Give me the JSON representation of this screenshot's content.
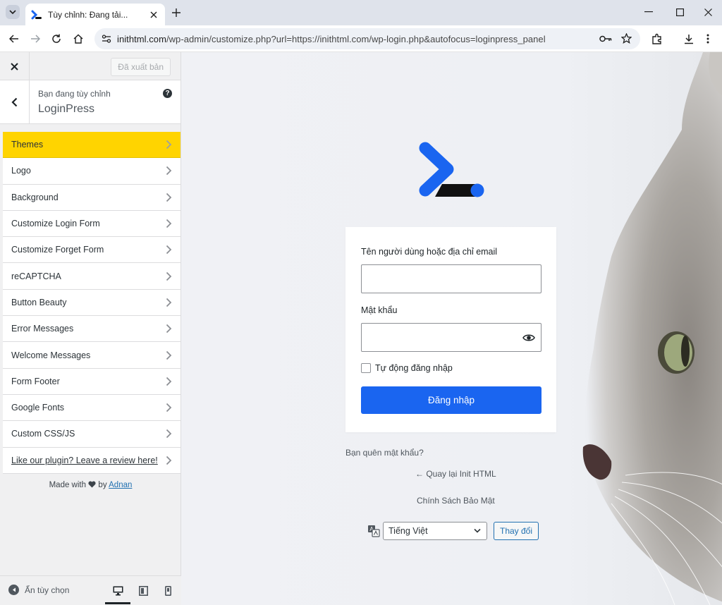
{
  "browser": {
    "tab_title": "Tùy chỉnh: Đang tải...",
    "url_host": "inithtml.com",
    "url_rest": "/wp-admin/customize.php?url=https://inithtml.com/wp-login.php&autofocus=loginpress_panel"
  },
  "sidebar": {
    "publish_label": "Đã xuất bản",
    "customizing_label": "Bạn đang tùy chỉnh",
    "panel_title": "LoginPress",
    "help": "?",
    "items": [
      {
        "label": "Themes"
      },
      {
        "label": "Logo"
      },
      {
        "label": "Background"
      },
      {
        "label": "Customize Login Form"
      },
      {
        "label": "Customize Forget Form"
      },
      {
        "label": "reCAPTCHA"
      },
      {
        "label": "Button Beauty"
      },
      {
        "label": "Error Messages"
      },
      {
        "label": "Welcome Messages"
      },
      {
        "label": "Form Footer"
      },
      {
        "label": "Google Fonts"
      },
      {
        "label": "Custom CSS/JS"
      },
      {
        "label": "Like our plugin? Leave a review here!"
      }
    ],
    "credit_prefix": "Made with",
    "credit_by": "by",
    "credit_author": "Adnan",
    "hide_controls": "Ẩn tùy chọn"
  },
  "login": {
    "username_label": "Tên người dùng hoặc địa chỉ email",
    "password_label": "Mật khẩu",
    "remember_label": "Tự động đăng nhập",
    "submit_label": "Đăng nhập",
    "lost_password": "Bạn quên mật khẩu?",
    "back_link": "← Quay lại Init HTML",
    "privacy": "Chính Sách Bảo Mật",
    "language_selected": "Tiếng Việt",
    "language_change": "Thay đổi"
  },
  "colors": {
    "active_item": "#ffd400",
    "submit": "#1a65f0",
    "logo_blue": "#1a65f0"
  }
}
